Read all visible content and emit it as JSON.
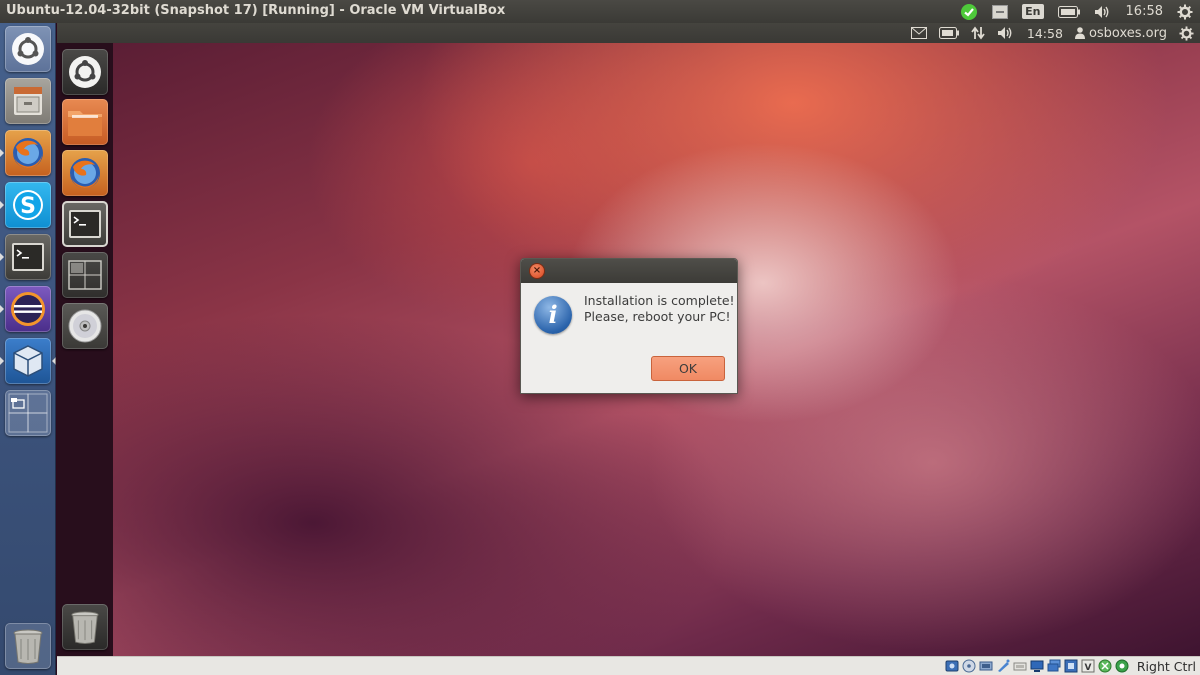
{
  "host": {
    "window_title": "Ubuntu-12.04-32bit (Snapshot 17) [Running] - Oracle VM VirtualBox",
    "tray": {
      "keyboard_layout": "En",
      "clock": "16:58"
    },
    "launcher": {
      "items": [
        {
          "name": "dash-home",
          "icon": "ubuntu-logo-icon"
        },
        {
          "name": "files",
          "icon": "file-cabinet-icon"
        },
        {
          "name": "firefox",
          "icon": "firefox-icon"
        },
        {
          "name": "skype",
          "icon": "skype-icon"
        },
        {
          "name": "terminal",
          "icon": "terminal-icon"
        },
        {
          "name": "eclipse",
          "icon": "eclipse-icon"
        },
        {
          "name": "virtualbox",
          "icon": "virtualbox-icon"
        },
        {
          "name": "workspace-switcher",
          "icon": "workspace-switcher-icon"
        },
        {
          "name": "trash",
          "icon": "trash-icon"
        }
      ]
    }
  },
  "guest": {
    "panel": {
      "clock": "14:58",
      "user": "osboxes.org"
    },
    "launcher": {
      "items": [
        {
          "name": "dash-home",
          "icon": "ubuntu-logo-icon"
        },
        {
          "name": "home-folder",
          "icon": "folder-icon"
        },
        {
          "name": "firefox",
          "icon": "firefox-icon"
        },
        {
          "name": "terminal",
          "icon": "terminal-icon"
        },
        {
          "name": "workspace-switcher",
          "icon": "workspace-switcher-icon"
        },
        {
          "name": "dvd",
          "icon": "disc-icon"
        },
        {
          "name": "trash",
          "icon": "trash-icon"
        }
      ]
    },
    "dialog": {
      "message_line1": "Installation is complete!",
      "message_line2": "Please, reboot your PC!",
      "ok_label": "OK"
    }
  },
  "vm_status": {
    "host_key": "Right Ctrl"
  },
  "colors": {
    "accent_orange": "#f08a63",
    "panel_dark": "#3c3b37",
    "host_launcher_blue": "#3e5680"
  }
}
